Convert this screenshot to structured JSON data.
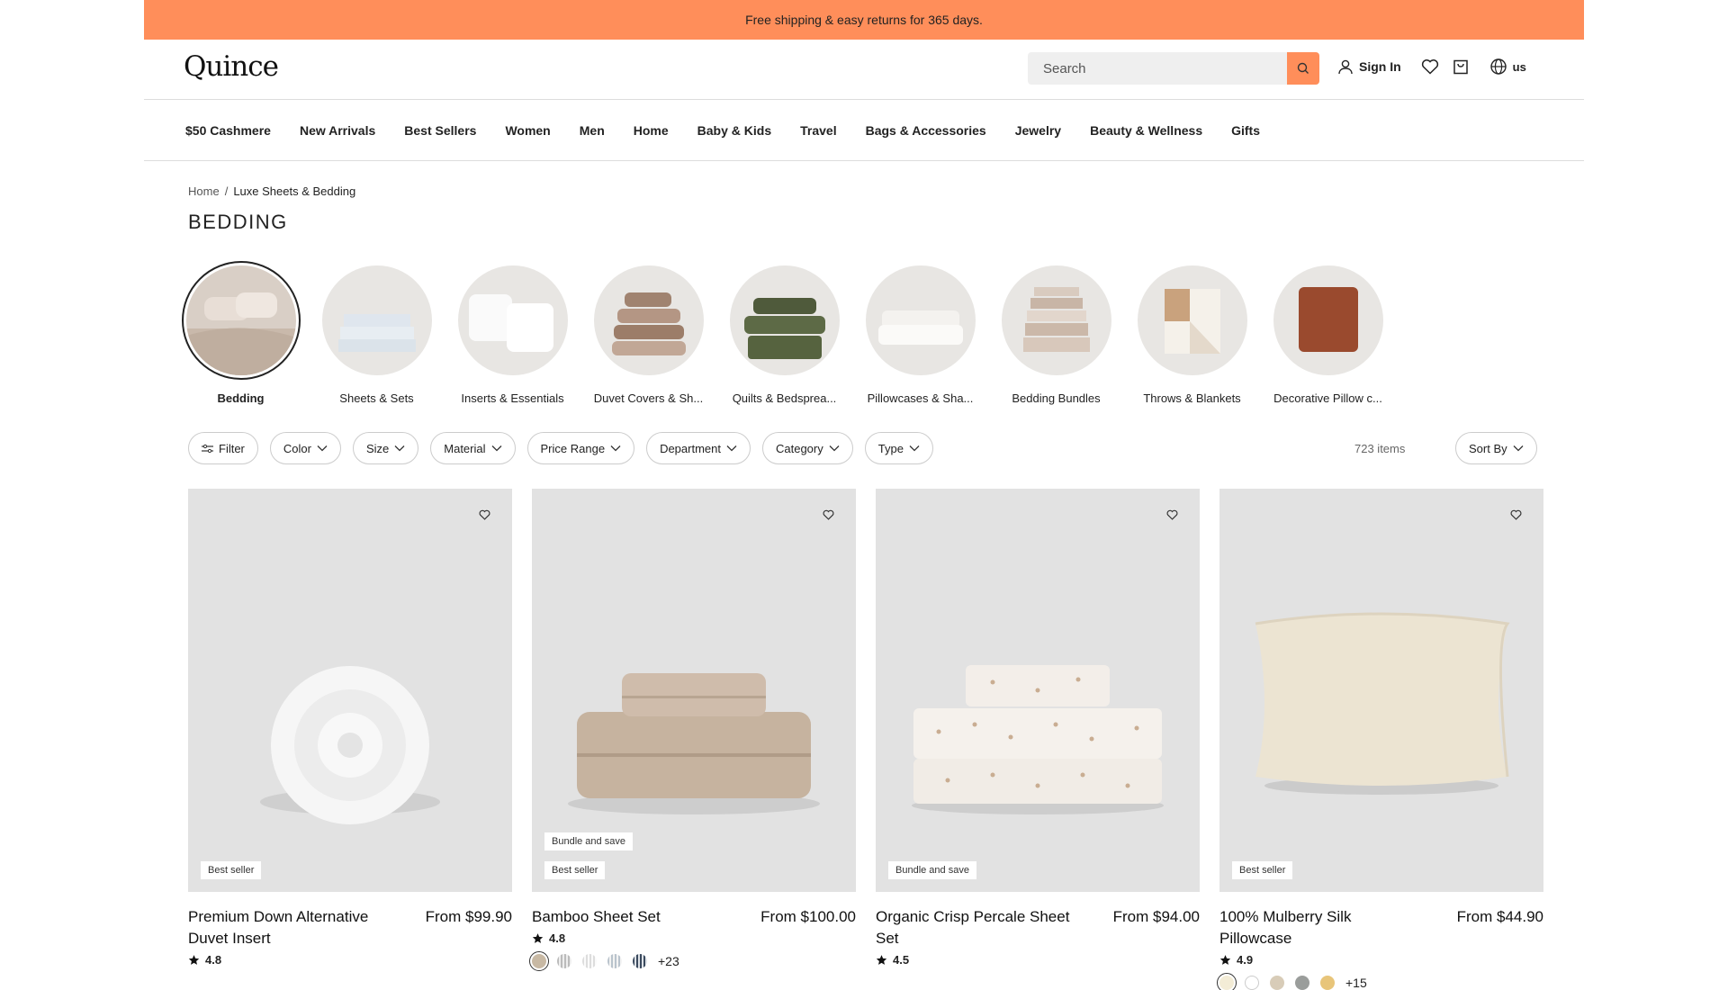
{
  "promo": "Free shipping & easy returns for 365 days.",
  "brand": "Quince",
  "search": {
    "placeholder": "Search"
  },
  "header": {
    "signin": "Sign In",
    "locale": "us"
  },
  "nav": [
    "$50 Cashmere",
    "New Arrivals",
    "Best Sellers",
    "Women",
    "Men",
    "Home",
    "Baby & Kids",
    "Travel",
    "Bags & Accessories",
    "Jewelry",
    "Beauty & Wellness",
    "Gifts"
  ],
  "breadcrumb": {
    "home": "Home",
    "sep": "/",
    "current": "Luxe Sheets & Bedding"
  },
  "page_title": "BEDDING",
  "categories": [
    "Bedding",
    "Sheets & Sets",
    "Inserts & Essentials",
    "Duvet Covers & Sh...",
    "Quilts & Bedsprea...",
    "Pillowcases & Sha...",
    "Bedding Bundles",
    "Throws & Blankets",
    "Decorative Pillow c..."
  ],
  "filters": {
    "filter": "Filter",
    "color": "Color",
    "size": "Size",
    "material": "Material",
    "price": "Price Range",
    "department": "Department",
    "category": "Category",
    "type": "Type"
  },
  "item_count": "723 items",
  "sort": "Sort By",
  "products": [
    {
      "name": "Premium Down Alternative Duvet Insert",
      "price": "From $99.90",
      "rating": "4.8",
      "badges": [
        "Best seller"
      ]
    },
    {
      "name": "Bamboo Sheet Set",
      "price": "From $100.00",
      "rating": "4.8",
      "badges": [
        "Bundle and save",
        "Best seller"
      ],
      "more_colors": "+23"
    },
    {
      "name": "Organic Crisp Percale Sheet Set",
      "price": "From $94.00",
      "rating": "4.5",
      "badges": [
        "Bundle and save"
      ]
    },
    {
      "name": "100% Mulberry Silk Pillowcase",
      "price": "From $44.90",
      "rating": "4.9",
      "badges": [
        "Best seller"
      ],
      "more_colors": "+15"
    }
  ],
  "colors": {
    "accent": "#ff8e5a",
    "tile": "#e2e2e2"
  }
}
